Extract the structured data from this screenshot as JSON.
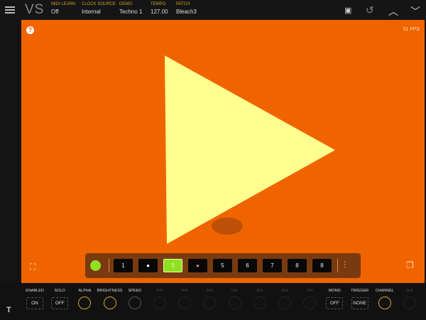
{
  "header": {
    "logo": "VS",
    "fields": [
      {
        "label": "MIDI LEARN",
        "value": "Off"
      },
      {
        "label": "CLOCK SOURCE",
        "value": "Internal"
      },
      {
        "label": "DEMO",
        "value": "Techno 1"
      },
      {
        "label": "TEMPO",
        "value": "127.00"
      },
      {
        "label": "PATCH",
        "value": "Bleach3"
      }
    ]
  },
  "stage": {
    "fps": "31 FPS",
    "help": "?",
    "background": "#f06400",
    "shape_color": "#ffff90"
  },
  "slots": {
    "items": [
      "1",
      "",
      "3",
      "",
      "5",
      "6",
      "7",
      "8",
      "8"
    ],
    "active_index": 2,
    "active_color": "#8fe020"
  },
  "controls": [
    {
      "label": "ENABLED",
      "value": "ON",
      "type": "button"
    },
    {
      "label": "SOLO",
      "value": "OFF",
      "type": "button"
    },
    {
      "label": "ALPHA",
      "type": "knob"
    },
    {
      "label": "BRIGHTNESS",
      "type": "knob"
    },
    {
      "label": "SPEED",
      "type": "knob"
    },
    {
      "label": "N/A",
      "type": "knob"
    },
    {
      "label": "N/A",
      "type": "knob"
    },
    {
      "label": "N/A",
      "type": "knob"
    },
    {
      "label": "N/A",
      "type": "knob"
    },
    {
      "label": "N/A",
      "type": "knob"
    },
    {
      "label": "N/A",
      "type": "knob"
    },
    {
      "label": "N/A",
      "type": "knob"
    },
    {
      "label": "MONO",
      "value": "OFF",
      "type": "button"
    },
    {
      "label": "TRIGGER",
      "value": "NONE",
      "type": "button"
    },
    {
      "label": "CHANNEL",
      "type": "knob"
    },
    {
      "label": "N/A",
      "type": "knob"
    }
  ]
}
